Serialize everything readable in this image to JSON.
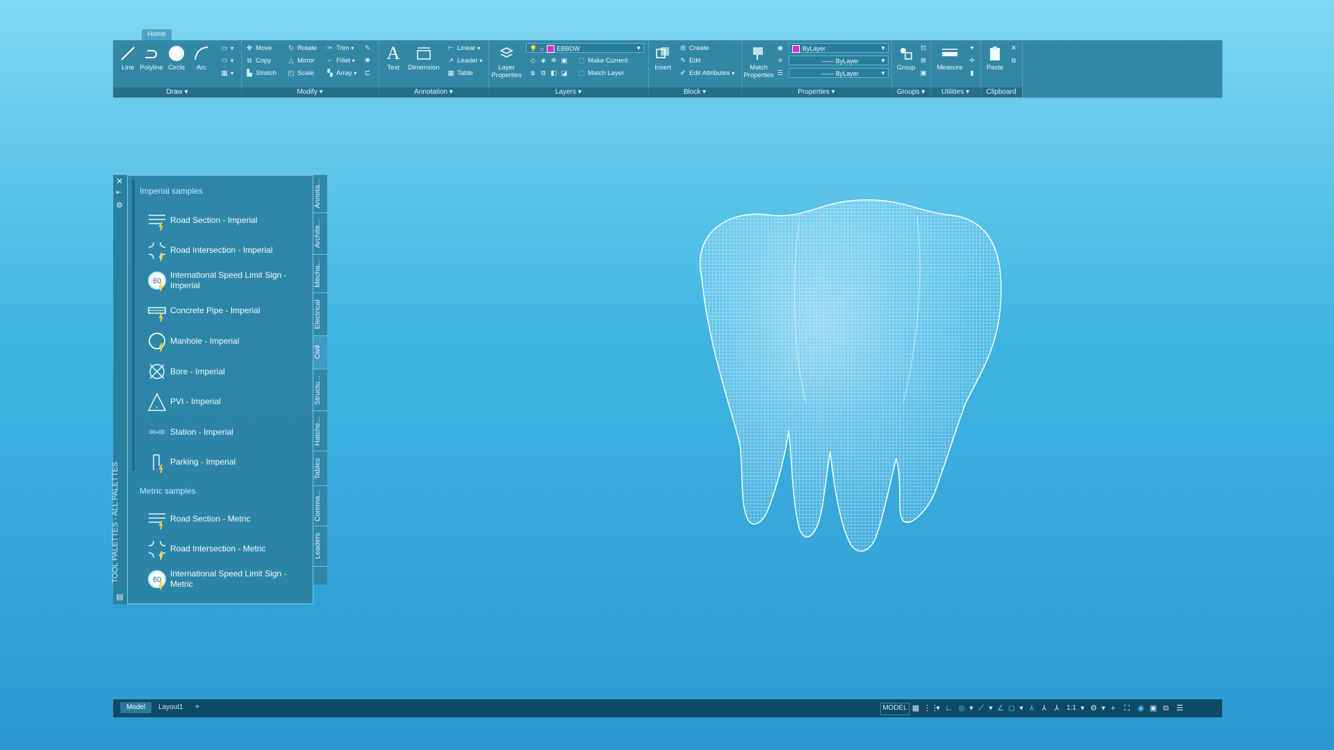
{
  "ribbon": {
    "active_tab": "Home",
    "panels": {
      "draw": {
        "title": "Draw",
        "line": "Line",
        "polyline": "Polyline",
        "circle": "Circle",
        "arc": "Arc"
      },
      "modify": {
        "title": "Modify",
        "move": "Move",
        "rotate": "Rotate",
        "trim": "Trim",
        "copy": "Copy",
        "mirror": "Mirror",
        "fillet": "Fillet",
        "stretch": "Stretch",
        "scale": "Scale",
        "array": "Array"
      },
      "annotation": {
        "title": "Annotation",
        "text": "Text",
        "dimension": "Dimension",
        "linear": "Linear",
        "leader": "Leader",
        "table": "Table"
      },
      "layers": {
        "title": "Layers",
        "layer_properties": "Layer Properties",
        "current_layer": "EBBDW",
        "make_current": "Make Current",
        "match_layer": "Match Layer"
      },
      "block": {
        "title": "Block",
        "insert": "Insert",
        "create": "Create",
        "edit": "Edit",
        "edit_attributes": "Edit Attributes"
      },
      "properties": {
        "title": "Properties",
        "match_properties": "Match Properties",
        "color": "ByLayer",
        "linetype": "ByLayer",
        "lineweight": "ByLayer"
      },
      "groups": {
        "title": "Groups",
        "group": "Group"
      },
      "utilities": {
        "title": "Utilities",
        "measure": "Measure"
      },
      "clipboard": {
        "title": "Clipboard",
        "paste": "Paste"
      }
    },
    "accent_color": "#e02ad2"
  },
  "palette": {
    "title": "TOOL PALETTES - ALL PALETTES",
    "imperial_header": "Imperial samples",
    "imperial_items": [
      {
        "label": "Road Section - Imperial",
        "icon": "road-section-icon"
      },
      {
        "label": "Road Intersection - Imperial",
        "icon": "road-intersection-icon"
      },
      {
        "label": "International Speed Limit Sign - Imperial",
        "icon": "speed-limit-sign-icon",
        "badge": "60"
      },
      {
        "label": "Concrete Pipe - Imperial",
        "icon": "concrete-pipe-icon"
      },
      {
        "label": "Manhole - Imperial",
        "icon": "manhole-icon"
      },
      {
        "label": "Bore - Imperial",
        "icon": "bore-icon"
      },
      {
        "label": "PVI - Imperial",
        "icon": "pvi-icon"
      },
      {
        "label": "Station - Imperial",
        "icon": "station-icon",
        "badge": "00+00"
      },
      {
        "label": "Parking - Imperial",
        "icon": "parking-icon"
      }
    ],
    "metric_header": "Metric samples",
    "metric_items": [
      {
        "label": "Road Section - Metric",
        "icon": "road-section-icon"
      },
      {
        "label": "Road Intersection - Metric",
        "icon": "road-intersection-icon"
      },
      {
        "label": "International Speed Limit Sign - Metric",
        "icon": "speed-limit-sign-icon",
        "badge": "60"
      }
    ],
    "tabs": [
      "Annota...",
      "Archite...",
      "Mecha...",
      "Electrical",
      "Civil",
      "Structu...",
      "Hatche...",
      "Tables",
      "Comma...",
      "Leaders"
    ],
    "active_tab": "Civil"
  },
  "statusbar": {
    "tabs": [
      "Model",
      "Layout1"
    ],
    "active_tab": "Model",
    "add_tab": "+",
    "model_label": "MODEL",
    "scale": "1:1"
  }
}
